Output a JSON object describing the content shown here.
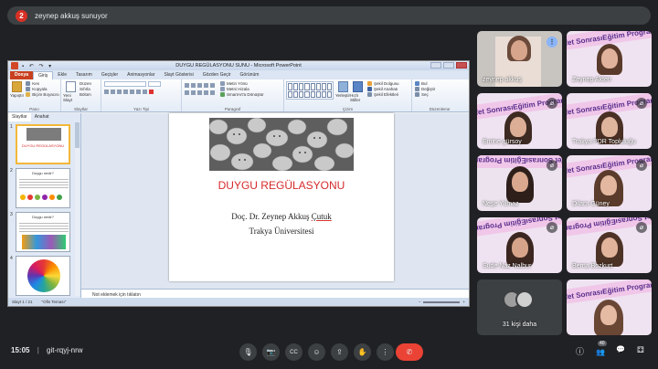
{
  "presenter_bar": {
    "avatar_letter": "2",
    "text": "zeynep akkuş sunuyor"
  },
  "ppt": {
    "window_title": "DUYGU REGÜLASYONU SUNU - Microsoft PowerPoint",
    "tabs": [
      "Dosya",
      "Giriş",
      "Ekle",
      "Tasarım",
      "Geçişler",
      "Animasyonlar",
      "Slayt Gösterisi",
      "Gözden Geçir",
      "Görünüm"
    ],
    "active_tab": "Giriş",
    "ribbon_groups": [
      "Pano",
      "Slaytlar",
      "Yazı Tipi",
      "Paragraf",
      "Çizim",
      "Düzenleme"
    ],
    "ribbon_cmds": {
      "paste": "Yapıştır",
      "cut": "Kes",
      "copy": "Kopyala",
      "format_painter": "Biçim Boyacısı",
      "new_slide": "Yeni Slayt",
      "layout": "Düzen",
      "reset": "Sıfırla",
      "section": "Bölüm",
      "text_direction": "Metin Yönü",
      "align_text": "Metni Hizala",
      "smartart": "SmartArt'a Dönüştür",
      "arrange": "Yerleştir",
      "quick_styles": "Hızlı Stiller",
      "shape_fill": "Şekil Dolgusu",
      "shape_outline": "Şekil Anahatı",
      "shape_effects": "Şekil Efektleri",
      "find": "Bul",
      "replace": "Değiştir",
      "select": "Seç"
    },
    "pane_tabs": [
      "Slaytlar",
      "Anahat"
    ],
    "slide": {
      "title": "DUYGU REGÜLASYONU",
      "author_prefix": "Doç. Dr. Zeynep Akkuş ",
      "author_underlined": "Çutuk",
      "university": "Trakya Üniversitesi"
    },
    "thumbs": [
      {
        "num": "1",
        "title": "DUYGU REGÜLASYONU"
      },
      {
        "num": "2",
        "title": "Duygu nedir?"
      },
      {
        "num": "3",
        "title": "Duygu nedir?"
      },
      {
        "num": "4",
        "title": ""
      }
    ],
    "notes_placeholder": "Not eklemek için tıklatın",
    "status": {
      "slide_info": "Slayt 1 / 21",
      "theme": "\"Ofis Teması\""
    }
  },
  "participants": [
    {
      "name": "zeynep akkuş",
      "muted": false,
      "more": true
    },
    {
      "name": "Zeynep Akten",
      "muted": false
    },
    {
      "name": "Emine gürsoy",
      "muted": true
    },
    {
      "name": "Trakya PDR Topluluğu",
      "muted": true
    },
    {
      "name": "Neşe Yılmaz",
      "muted": true
    },
    {
      "name": "Dilara Güney",
      "muted": true
    },
    {
      "name": "Sude Naz Nalbur",
      "muted": true
    },
    {
      "name": "Berna Bozkurt",
      "muted": true
    },
    {
      "name": "31 kişi daha"
    },
    {
      "name": ""
    }
  ],
  "banner_text": "Afet SonrasıEğitim Programı",
  "bottom": {
    "time": "15:05",
    "meeting_code": "git-rqyj-nrw",
    "participant_count": "40"
  },
  "icons": {
    "mic": "🎙",
    "camera": "📷",
    "captions": "CC",
    "emoji": "☺",
    "present": "⇪",
    "hand": "✋",
    "more": "⋮",
    "end": "✆",
    "info": "ⓘ",
    "people": "👥",
    "chat": "💬",
    "activities": "⚃",
    "muted": "⌀"
  },
  "colors": {
    "end_call": "#ea4335",
    "slide_title": "#d62a2a",
    "banner": "#f0c7e9",
    "presenter_badge": "#d93025"
  }
}
